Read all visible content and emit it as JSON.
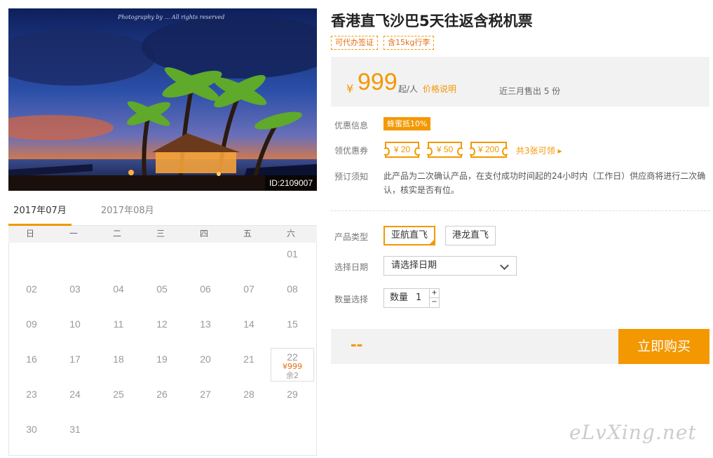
{
  "photo": {
    "watermark": "Photography by ... All rights reserved",
    "id_label": "ID:2109007"
  },
  "calendar": {
    "tabs": [
      "2017年07月",
      "2017年08月"
    ],
    "weekdays": [
      "日",
      "一",
      "二",
      "三",
      "四",
      "五",
      "六"
    ],
    "first_weekday_index": 6,
    "days_in_month": 31,
    "priced_days": {
      "22": {
        "price": "¥999",
        "remain": "余2"
      }
    }
  },
  "product": {
    "title": "香港直飞沙巴5天往返含税机票",
    "tags": [
      "可代办签证",
      "含15kg行李"
    ],
    "price": {
      "currency": "¥",
      "amount": "999",
      "unit": "起/人",
      "explain_link": "价格说明",
      "sold": "近三月售出 5 份"
    }
  },
  "promo": {
    "label": "优惠信息",
    "badge": "蜂蜜抵10%"
  },
  "coupons": {
    "label": "领优惠券",
    "items": [
      "¥ 20",
      "¥ 50",
      "¥ 200"
    ],
    "more": "共3张可领 ▸"
  },
  "booking_notice": {
    "label": "预订须知",
    "text": "此产品为二次确认产品，在支付成功时间起的24小时内（工作日）供应商将进行二次确认，核实是否有位。"
  },
  "product_type": {
    "label": "产品类型",
    "options": [
      "亚航直飞",
      "港龙直飞"
    ],
    "selected_index": 0
  },
  "date_select": {
    "label": "选择日期",
    "value": "请选择日期"
  },
  "quantity": {
    "label": "数量选择",
    "prefix": "数量",
    "value": "1",
    "plus": "+",
    "minus": "−"
  },
  "purchase": {
    "total": "--",
    "button": "立即购买"
  },
  "site_watermark": "eLvXing.net",
  "colors": {
    "accent": "#f39800",
    "accent_text": "#e96b0f",
    "panel_bg": "#f2f2f2"
  }
}
